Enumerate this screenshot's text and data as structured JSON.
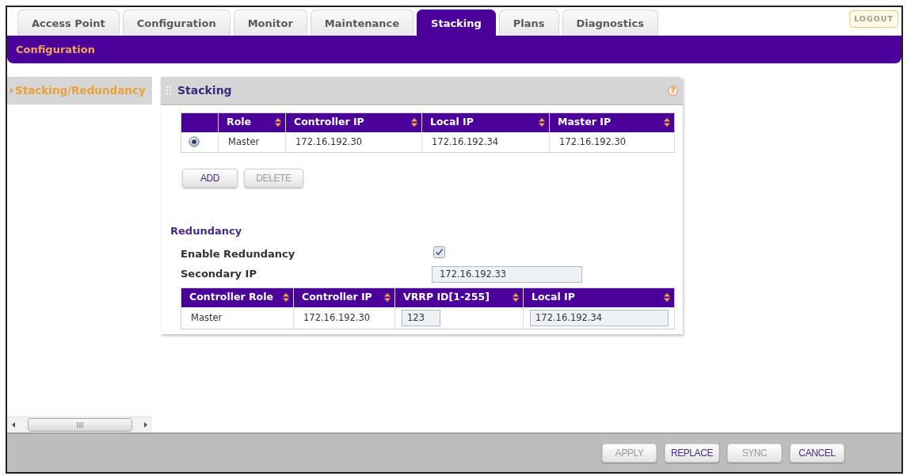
{
  "tabs": [
    {
      "label": "Access Point",
      "selected": false
    },
    {
      "label": "Configuration",
      "selected": false
    },
    {
      "label": "Monitor",
      "selected": false
    },
    {
      "label": "Maintenance",
      "selected": false
    },
    {
      "label": "Stacking",
      "selected": true
    },
    {
      "label": "Plans",
      "selected": false
    },
    {
      "label": "Diagnostics",
      "selected": false
    }
  ],
  "logout_button": {
    "label": "LOGOUT"
  },
  "section_bar": {
    "title": "Configuration"
  },
  "sidebar": {
    "items": [
      {
        "label": "Stacking/Redundancy",
        "selected": true
      }
    ]
  },
  "stacking_panel": {
    "title": "Stacking",
    "help": "?",
    "table": {
      "columns": [
        "Role",
        "Controller IP",
        "Local IP",
        "Master IP"
      ],
      "rows": [
        {
          "selected": true,
          "cells": [
            "Master",
            "172.16.192.30",
            "172.16.192.34",
            "172.16.192.30"
          ]
        }
      ]
    },
    "buttons": [
      {
        "label": "ADD",
        "disabled": false
      },
      {
        "label": "DELETE",
        "disabled": true
      }
    ],
    "redundancy": {
      "title": "Redundancy",
      "fields": [
        {
          "kind": "checkbox",
          "label": "Enable Redundancy",
          "checked": true
        },
        {
          "kind": "text",
          "label": "Secondary IP",
          "value": "172.16.192.33"
        }
      ],
      "table": {
        "columns": [
          "Controller Role",
          "Controller IP",
          "VRRP ID[1-255]",
          "Local IP"
        ],
        "rows": [
          {
            "cells": [
              {
                "kind": "text",
                "value": "Master"
              },
              {
                "kind": "text",
                "value": "172.16.192.30"
              },
              {
                "kind": "input",
                "value": "123"
              },
              {
                "kind": "input",
                "value": "172.16.192.34"
              }
            ]
          }
        ]
      }
    }
  },
  "footer_buttons": [
    {
      "label": "APPLY",
      "disabled": true
    },
    {
      "label": "REPLACE",
      "disabled": false
    },
    {
      "label": "SYNC",
      "disabled": true
    },
    {
      "label": "CANCEL",
      "disabled": false
    }
  ]
}
